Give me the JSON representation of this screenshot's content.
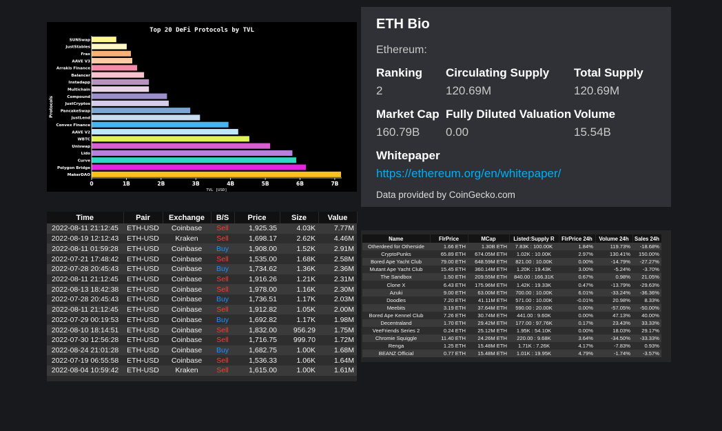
{
  "chart_data": {
    "type": "bar",
    "orientation": "horizontal",
    "title": "Top 20 DeFi Protocols by TVL",
    "xlabel": "TVL [USD]",
    "ylabel": "Protocols",
    "xlim": [
      0,
      7.2
    ],
    "xticks": [
      "0",
      "1B",
      "2B",
      "3B",
      "4B",
      "5B",
      "6B",
      "7B"
    ],
    "grid": false,
    "categories": [
      "SUNSwap",
      "JustStables",
      "Frax",
      "AAVE V3",
      "Arrakis Finance",
      "Balancer",
      "Instadapp",
      "Multichain",
      "Compound",
      "JustCryptos",
      "PancakeSwap",
      "JustLend",
      "Convex Finance",
      "AAVE V2",
      "WBTC",
      "Uniswap",
      "Lido",
      "Curve",
      "Polygon Bridge",
      "MakerDAO"
    ],
    "values": [
      0.71,
      1.01,
      1.13,
      1.17,
      1.31,
      1.51,
      1.65,
      1.65,
      2.17,
      2.22,
      2.84,
      3.12,
      3.94,
      4.22,
      4.54,
      5.14,
      5.78,
      5.89,
      6.17,
      7.18
    ],
    "colors": [
      "#fff68f",
      "#fff8c6",
      "#ffb173",
      "#ffcba6",
      "#f58aa9",
      "#f9c2cf",
      "#b793c0",
      "#e8d4e6",
      "#9b8fc9",
      "#d6cdea",
      "#7ba5d3",
      "#c8dcf0",
      "#48b4ef",
      "#bfe6fb",
      "#dff25b",
      "#d85fd0",
      "#b97fde",
      "#2dd9c3",
      "#e325e3",
      "#f7c31b"
    ]
  },
  "bio": {
    "title": "ETH Bio",
    "name": "Ethereum:",
    "ranking_label": "Ranking",
    "ranking": "2",
    "circ_label": "Circulating Supply",
    "circ": "120.69M",
    "total_label": "Total Supply",
    "total": "120.69M",
    "mcap_label": "Market Cap",
    "mcap": "160.79B",
    "fdv_label": "Fully Diluted Valuation",
    "fdv": "0.00",
    "volume_label": "Volume",
    "volume": "15.54B",
    "whitepaper_label": "Whitepaper",
    "whitepaper_url": "https://ethereum.org/en/whitepaper/",
    "footer": "Data provided by CoinGecko.com"
  },
  "trades": {
    "columns": [
      "Time",
      "Pair",
      "Exchange",
      "B/S",
      "Price",
      "Size",
      "Value"
    ],
    "rows": [
      [
        "2022-08-11 21:12:45",
        "ETH-USD",
        "Coinbase",
        "Sell",
        "1,925.35",
        "4.03K",
        "7.77M"
      ],
      [
        "2022-08-19 12:12:43",
        "ETH-USD",
        "Kraken",
        "Sell",
        "1,698.17",
        "2.62K",
        "4.46M"
      ],
      [
        "2022-08-11 01:59:28",
        "ETH-USD",
        "Coinbase",
        "Buy",
        "1,908.00",
        "1.52K",
        "2.91M"
      ],
      [
        "2022-07-21 17:48:42",
        "ETH-USD",
        "Coinbase",
        "Sell",
        "1,535.00",
        "1.68K",
        "2.58M"
      ],
      [
        "2022-07-28 20:45:43",
        "ETH-USD",
        "Coinbase",
        "Buy",
        "1,734.62",
        "1.36K",
        "2.36M"
      ],
      [
        "2022-08-11 21:12:45",
        "ETH-USD",
        "Coinbase",
        "Sell",
        "1,916.26",
        "1.21K",
        "2.31M"
      ],
      [
        "2022-08-13 18:42:38",
        "ETH-USD",
        "Coinbase",
        "Sell",
        "1,978.00",
        "1.16K",
        "2.30M"
      ],
      [
        "2022-07-28 20:45:43",
        "ETH-USD",
        "Coinbase",
        "Buy",
        "1,736.51",
        "1.17K",
        "2.03M"
      ],
      [
        "2022-08-11 21:12:45",
        "ETH-USD",
        "Coinbase",
        "Sell",
        "1,912.82",
        "1.05K",
        "2.00M"
      ],
      [
        "2022-07-29 00:19:53",
        "ETH-USD",
        "Coinbase",
        "Buy",
        "1,692.82",
        "1.17K",
        "1.98M"
      ],
      [
        "2022-08-10 18:14:51",
        "ETH-USD",
        "Coinbase",
        "Sell",
        "1,832.00",
        "956.29",
        "1.75M"
      ],
      [
        "2022-07-30 12:56:28",
        "ETH-USD",
        "Coinbase",
        "Sell",
        "1,716.75",
        "999.70",
        "1.72M"
      ],
      [
        "2022-08-24 21:01:28",
        "ETH-USD",
        "Coinbase",
        "Buy",
        "1,682.75",
        "1.00K",
        "1.68M"
      ],
      [
        "2022-07-19 06:55:58",
        "ETH-USD",
        "Coinbase",
        "Sell",
        "1,536.33",
        "1.06K",
        "1.64M"
      ],
      [
        "2022-08-04 10:59:42",
        "ETH-USD",
        "Kraken",
        "Sell",
        "1,615.00",
        "1.00K",
        "1.61M"
      ]
    ]
  },
  "nft": {
    "columns": [
      "Name",
      "FlrPrice",
      "MCap",
      "Listed:Supply R",
      "FlrPrice 24h",
      "Volume 24h",
      "Sales 24h"
    ],
    "rows": [
      [
        "Otherdeed for Otherside",
        "1.66 ETH",
        "1.30B ETH",
        "7.83K : 100.00K",
        "1.84%",
        "119.73%",
        "-18.68%"
      ],
      [
        "CryptoPunks",
        "65.89 ETH",
        "674.05M ETH",
        "1.02K : 10.00K",
        "2.97%",
        "130.41%",
        "150.00%"
      ],
      [
        "Bored Ape Yacht Club",
        "79.00 ETH",
        "648.59M ETH",
        "821.00 : 10.00K",
        "0.00%",
        "-14.79%",
        "-27.27%"
      ],
      [
        "Mutant Ape Yacht Club",
        "15.45 ETH",
        "360.14M ETH",
        "1.20K : 19.43K",
        "3.00%",
        "-5.24%",
        "-3.70%"
      ],
      [
        "The Sandbox",
        "1.50 ETH",
        "209.55M ETH",
        "840.00 : 166.31K",
        "0.67%",
        "0.98%",
        "21.05%"
      ],
      [
        "Clone X",
        "6.43 ETH",
        "175.96M ETH",
        "1.42K : 19.33K",
        "0.47%",
        "-13.79%",
        "-29.63%"
      ],
      [
        "Azuki",
        "9.00 ETH",
        "63.00M ETH",
        "700.00 : 10.00K",
        "6.01%",
        "-33.24%",
        "-36.36%"
      ],
      [
        "Doodles",
        "7.20 ETH",
        "41.11M ETH",
        "571.00 : 10.00K",
        "-0.01%",
        "20.98%",
        "8.33%"
      ],
      [
        "Meebits",
        "3.19 ETH",
        "37.64M ETH",
        "590.00 : 20.00K",
        "0.00%",
        "-57.05%",
        "-50.00%"
      ],
      [
        "Bored Ape Kennel Club",
        "7.26 ETH",
        "30.74M ETH",
        "441.00 : 9.60K",
        "0.00%",
        "47.13%",
        "40.00%"
      ],
      [
        "Decentraland",
        "1.70 ETH",
        "29.42M ETH",
        "177.00 : 97.76K",
        "0.17%",
        "23.43%",
        "33.33%"
      ],
      [
        "VeeFriends Series 2",
        "0.24 ETH",
        "25.12M ETH",
        "1.95K : 54.10K",
        "0.00%",
        "18.03%",
        "29.17%"
      ],
      [
        "Chromie Squiggle",
        "11.40 ETH",
        "24.26M ETH",
        "220.00 : 9.68K",
        "3.64%",
        "-34.50%",
        "-33.33%"
      ],
      [
        "Renga",
        "1.25 ETH",
        "15.48M ETH",
        "1.71K : 7.26K",
        "4.17%",
        "-7.83%",
        "0.93%"
      ],
      [
        "BEANZ Official",
        "0.77 ETH",
        "15.48M ETH",
        "1.01K : 19.95K",
        "4.79%",
        "-1.74%",
        "-3.57%"
      ]
    ]
  }
}
